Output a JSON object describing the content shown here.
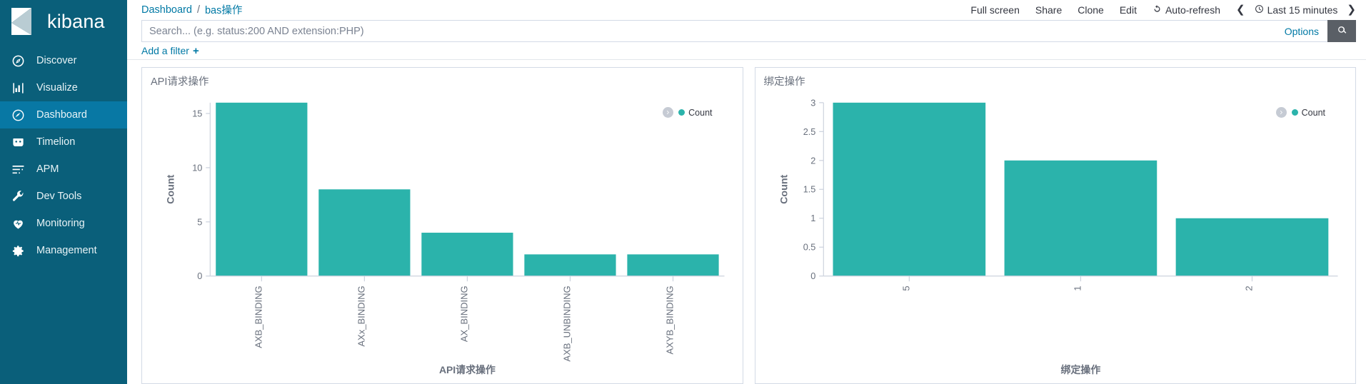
{
  "brand": {
    "name": "kibana"
  },
  "sidebar": {
    "items": [
      {
        "label": "Discover",
        "icon": "compass-icon",
        "active": false
      },
      {
        "label": "Visualize",
        "icon": "bar-chart-icon",
        "active": false
      },
      {
        "label": "Dashboard",
        "icon": "dashboard-icon",
        "active": true
      },
      {
        "label": "Timelion",
        "icon": "timelion-icon",
        "active": false
      },
      {
        "label": "APM",
        "icon": "apm-icon",
        "active": false
      },
      {
        "label": "Dev Tools",
        "icon": "wrench-icon",
        "active": false
      },
      {
        "label": "Monitoring",
        "icon": "heartbeat-icon",
        "active": false
      },
      {
        "label": "Management",
        "icon": "gear-icon",
        "active": false
      }
    ]
  },
  "breadcrumb": {
    "root": "Dashboard",
    "separator": "/",
    "current": "bas操作"
  },
  "top_actions": {
    "full_screen": "Full screen",
    "share": "Share",
    "clone": "Clone",
    "edit": "Edit",
    "auto_refresh": "Auto-refresh",
    "time_range": "Last 15 minutes",
    "prev_arrow": "❮",
    "next_arrow": "❯"
  },
  "query_bar": {
    "value": "",
    "placeholder": "Search... (e.g. status:200 AND extension:PHP)",
    "options_label": "Options",
    "search_icon": "search-icon"
  },
  "filter_bar": {
    "add_filter_label": "Add a filter",
    "plus": "+"
  },
  "colors": {
    "sidebar_bg": "#0a5f7a",
    "sidebar_active": "#0878a4",
    "bar_teal": "#2bb3ab",
    "link_blue": "#0079a5",
    "axis_gray": "#69707d"
  },
  "panels": [
    {
      "title": "API请求操作",
      "legend_label": "Count"
    },
    {
      "title": "绑定操作",
      "legend_label": "Count"
    }
  ],
  "chart_data": [
    {
      "type": "bar",
      "title": "API请求操作",
      "categories": [
        "AXB_BINDING",
        "AXx_BINDING",
        "AX_BINDING",
        "AXB_UNBINDING",
        "AXYB_BINDING"
      ],
      "values": [
        16,
        8,
        4,
        2,
        2
      ],
      "series": [
        {
          "name": "Count",
          "values": [
            16,
            8,
            4,
            2,
            2
          ]
        }
      ],
      "xlabel": "API请求操作",
      "ylabel": "Count",
      "ylim": [
        0,
        16
      ],
      "yticks": [
        0,
        5,
        10,
        15
      ],
      "ytick_labels": [
        "0",
        "5",
        "10",
        "15"
      ],
      "grid": false,
      "legend_position": "top-right",
      "legend_entries": [
        "Count"
      ]
    },
    {
      "type": "bar",
      "title": "绑定操作",
      "categories": [
        "5",
        "1",
        "2"
      ],
      "values": [
        3,
        2,
        1
      ],
      "series": [
        {
          "name": "Count",
          "values": [
            3,
            2,
            1
          ]
        }
      ],
      "xlabel": "绑定操作",
      "ylabel": "Count",
      "ylim": [
        0,
        3
      ],
      "yticks": [
        0,
        0.5,
        1,
        1.5,
        2,
        2.5,
        3
      ],
      "ytick_labels": [
        "0",
        "0.5",
        "1",
        "1.5",
        "2",
        "2.5",
        "3"
      ],
      "grid": false,
      "legend_position": "top-right",
      "legend_entries": [
        "Count"
      ]
    }
  ]
}
